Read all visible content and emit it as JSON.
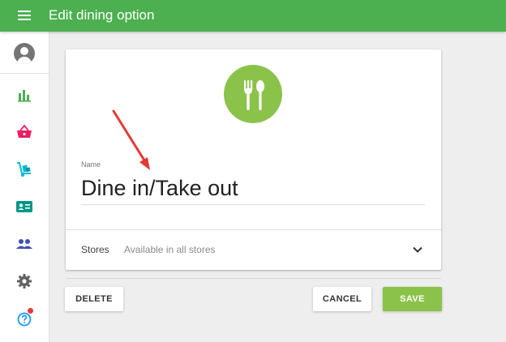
{
  "header": {
    "title": "Edit dining option",
    "menu_icon": "hamburger-menu-icon",
    "background_color": "#4caf50"
  },
  "sidebar": {
    "items": [
      {
        "name": "avatar",
        "icon": "account-circle-icon"
      },
      {
        "name": "reports",
        "icon": "bar-chart-icon",
        "color": "#4caf50"
      },
      {
        "name": "items",
        "icon": "basket-icon",
        "color": "#e91e63"
      },
      {
        "name": "inventory",
        "icon": "hand-truck-icon",
        "color": "#00bcd4"
      },
      {
        "name": "customers",
        "icon": "id-card-icon",
        "color": "#009688"
      },
      {
        "name": "employees",
        "icon": "people-icon",
        "color": "#3f51b5"
      },
      {
        "name": "settings",
        "icon": "gear-icon",
        "color": "#616161"
      },
      {
        "name": "help",
        "icon": "help-circle-icon",
        "color": "#2196f3",
        "notification_dot": true
      }
    ]
  },
  "form": {
    "icon": "fork-spoon-icon",
    "icon_color": "#8bc34a",
    "name_label": "Name",
    "name_value": "Dine in/Take out",
    "stores_label": "Stores",
    "stores_value": "Available in all stores"
  },
  "actions": {
    "delete_label": "DELETE",
    "cancel_label": "CANCEL",
    "save_label": "SAVE",
    "save_color": "#8bc34a"
  },
  "annotation": {
    "type": "red-arrow",
    "color": "#e53935",
    "points_to": "name-input"
  }
}
